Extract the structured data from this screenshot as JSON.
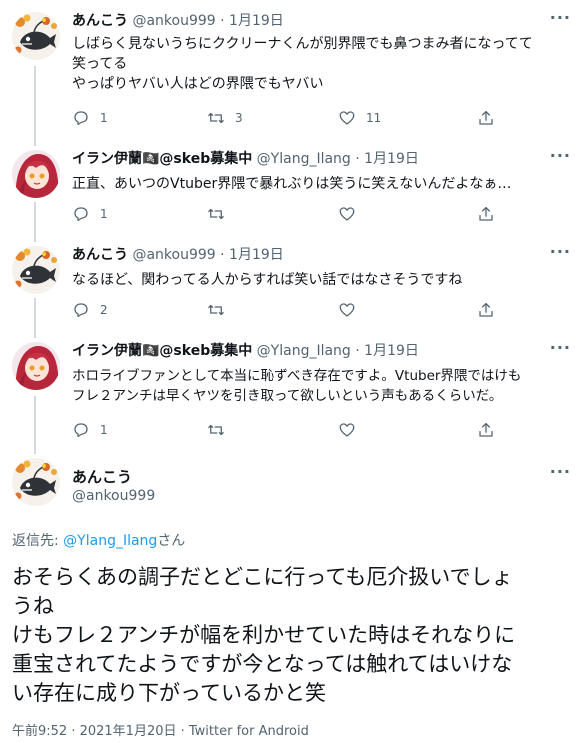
{
  "tweets": [
    {
      "name": "あんこう",
      "handle": "@ankou999",
      "date": "1月19日",
      "text": "しばらく見ないうちにククリーナくんが別界隈でも鼻つまみ者になってて\n笑ってる\nやっぱりヤバい人はどの界隈でもヤバい",
      "replies": "1",
      "retweets": "3",
      "likes": "11",
      "avatar": "anglerfish-avatar"
    },
    {
      "name": "イラン伊蘭🏴‍☠️@skeb募集中",
      "handle": "@Ylang_Ilang",
      "date": "1月19日",
      "text": "正直、あいつのVtuber界隈で暴れぶりは笑うに笑えないんだよなぁ…",
      "replies": "1",
      "retweets": "",
      "likes": "",
      "avatar": "red-hair-girl-avatar"
    },
    {
      "name": "あんこう",
      "handle": "@ankou999",
      "date": "1月19日",
      "text": "なるほど、関わってる人からすれば笑い話ではなさそうですね",
      "replies": "2",
      "retweets": "",
      "likes": "",
      "avatar": "anglerfish-avatar"
    },
    {
      "name": "イラン伊蘭🏴‍☠️@skeb募集中",
      "handle": "@Ylang_Ilang",
      "date": "1月19日",
      "text": "ホロライブファンとして本当に恥ずべき存在ですよ。Vtuber界隈ではけも\nフレ２アンチは早くヤツを引き取って欲しいという声もあるくらいだ。",
      "replies": "1",
      "retweets": "",
      "likes": "",
      "avatar": "red-hair-girl-avatar"
    }
  ],
  "separator": "·",
  "main": {
    "name": "あんこう",
    "handle": "@ankou999",
    "reply_prefix": "返信先: ",
    "reply_to": "@Ylang_Ilang",
    "reply_suffix": "さん",
    "text": "おそらくあの調子だとどこに行っても厄介扱いでしょ\nうね\nけもフレ２アンチが幅を利かせていた時はそれなりに\n重宝されてたようですが今となっては触れてはいけな\nい存在に成り下がっているかと笑",
    "timestamp": "午前9:52 · 2021年1月20日 · Twitter for Android"
  },
  "colors": {
    "text": "#0f1419",
    "muted": "#536471",
    "link": "#1d9bf0",
    "thread_line": "#cfd9de"
  }
}
